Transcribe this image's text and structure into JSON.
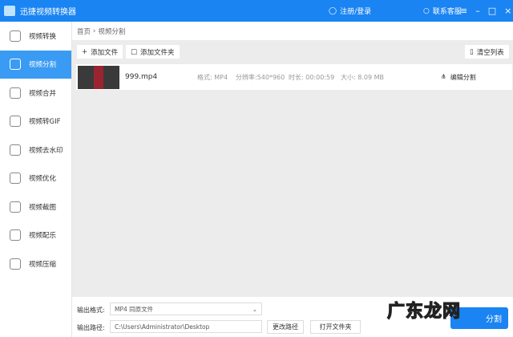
{
  "app": {
    "title": "迅捷视频转换器",
    "login": "注册/登录",
    "support": "联系客服"
  },
  "sidebar": {
    "items": [
      {
        "label": "视频转换"
      },
      {
        "label": "视频分割"
      },
      {
        "label": "视频合并"
      },
      {
        "label": "视频转GIF"
      },
      {
        "label": "视频去水印"
      },
      {
        "label": "视频优化"
      },
      {
        "label": "视频截图"
      },
      {
        "label": "视频配乐"
      },
      {
        "label": "视频压缩"
      }
    ],
    "active": 1
  },
  "breadcrumb": {
    "home": "首页",
    "sep": "›",
    "current": "视频分割"
  },
  "toolbar": {
    "add_file": "添加文件",
    "add_folder": "添加文件夹",
    "clear": "清空列表"
  },
  "files": [
    {
      "name": "999.mp4",
      "format": "格式: MP4",
      "resolution": "分辨率:540*960",
      "duration": "时长: 00:00:59",
      "size": "大小: 8.09 MB",
      "action": "编辑分割"
    }
  ],
  "output": {
    "format_label": "输出格式:",
    "format_value": "MP4  同原文件",
    "path_label": "输出路径:",
    "path_value": "C:\\Users\\Administrator\\Desktop",
    "change_path": "更改路径",
    "open_folder": "打开文件夹",
    "start": "分割"
  },
  "watermark": "广东龙网",
  "colors": {
    "accent": "#1a84f2",
    "active": "#3a9bf4"
  }
}
